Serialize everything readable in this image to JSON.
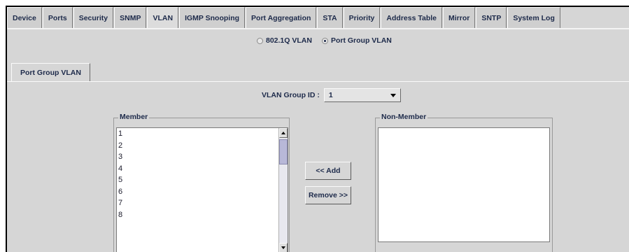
{
  "tabs": [
    {
      "label": "Device"
    },
    {
      "label": "Ports"
    },
    {
      "label": "Security"
    },
    {
      "label": "SNMP"
    },
    {
      "label": "VLAN",
      "active": true
    },
    {
      "label": "IGMP Snooping"
    },
    {
      "label": "Port Aggregation"
    },
    {
      "label": "STA"
    },
    {
      "label": "Priority"
    },
    {
      "label": "Address Table"
    },
    {
      "label": "Mirror"
    },
    {
      "label": "SNTP"
    },
    {
      "label": "System Log"
    }
  ],
  "vlan_mode": {
    "options": [
      "802.1Q VLAN",
      "Port Group VLAN"
    ],
    "selected": "Port Group VLAN"
  },
  "subtab": {
    "label": "Port Group VLAN"
  },
  "group_id": {
    "label": "VLAN Group ID :",
    "value": "1"
  },
  "member": {
    "legend": "Member",
    "items": [
      "1",
      "2",
      "3",
      "4",
      "5",
      "6",
      "7",
      "8"
    ]
  },
  "non_member": {
    "legend": "Non-Member",
    "items": []
  },
  "buttons": {
    "add": "<< Add",
    "remove": "Remove >>"
  }
}
